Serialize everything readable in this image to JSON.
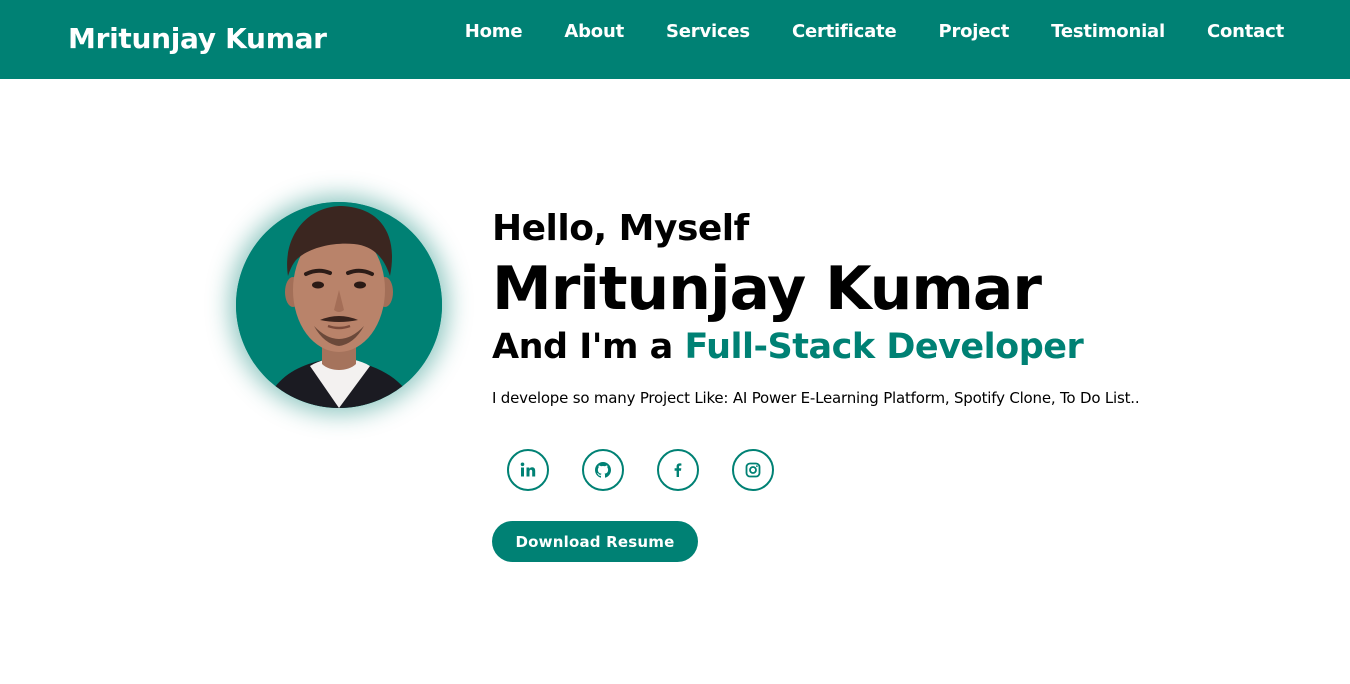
{
  "brand": {
    "name": "Mritunjay Kumar"
  },
  "nav": {
    "items": [
      {
        "label": "Home"
      },
      {
        "label": "About"
      },
      {
        "label": "Services"
      },
      {
        "label": "Certificate"
      },
      {
        "label": "Project"
      },
      {
        "label": "Testimonial"
      },
      {
        "label": "Contact"
      }
    ]
  },
  "hero": {
    "greeting": "Hello, Myself",
    "name": "Mritunjay Kumar",
    "role_prefix": "And I'm a ",
    "role": "Full-Stack Developer",
    "description": "I develope so many Project Like: AI Power E-Learning Platform, Spotify Clone, To Do List..",
    "cta_label": "Download Resume"
  },
  "socials": [
    {
      "icon": "linkedin-icon"
    },
    {
      "icon": "github-icon"
    },
    {
      "icon": "facebook-icon"
    },
    {
      "icon": "instagram-icon"
    }
  ],
  "colors": {
    "accent": "#008174",
    "text": "#000000",
    "background": "#ffffff"
  }
}
